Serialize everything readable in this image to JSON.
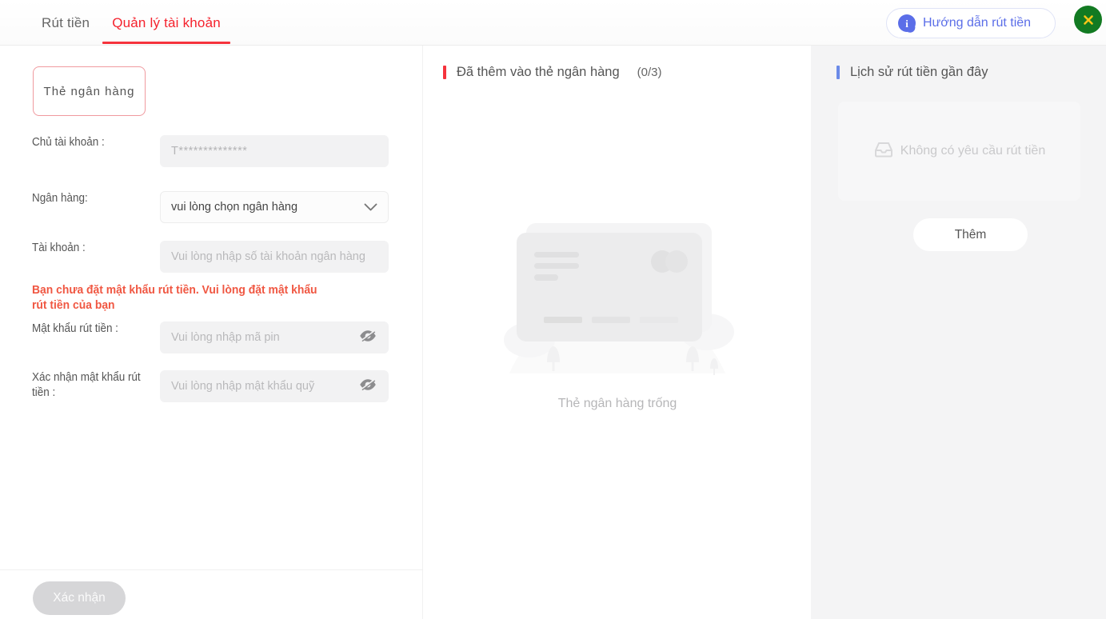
{
  "header": {
    "tabs": [
      {
        "label": "Rút tiền",
        "active": false
      },
      {
        "label": "Quản lý tài khoản",
        "active": true
      }
    ],
    "guide_button": {
      "label": "Hướng dẫn rút tiền",
      "icon": "info-bubble-icon"
    },
    "close_button": {
      "icon": "close-icon"
    }
  },
  "left_panel": {
    "card_tab_label": "Thẻ ngân hàng",
    "fields": [
      {
        "label": "Chủ tài khoản :",
        "value": "T**************",
        "placeholder": ""
      },
      {
        "label": "Ngân hàng:",
        "value": "vui lòng chọn ngân hàng",
        "placeholder": "vui lòng chọn ngân hàng"
      },
      {
        "label": "Tài khoản :",
        "value": "",
        "placeholder": "Vui lòng nhập số tài khoản ngân hàng"
      },
      {
        "label": "Mật khẩu rút tiền :",
        "value": "",
        "placeholder": "Vui lòng nhập mã pin"
      },
      {
        "label": "Xác nhận mật khẩu rút tiền :",
        "value": "",
        "placeholder": "Vui lòng nhập mật khẩu quỹ"
      }
    ],
    "warning": "Bạn chưa đặt mật khẩu rút tiền. Vui lòng đặt mật khẩu rút tiền của bạn",
    "confirm_label": "Xác nhận"
  },
  "middle_panel": {
    "title": "Đã thêm vào thẻ ngân hàng",
    "count": "(0/3)",
    "empty_caption": "Thẻ ngân hàng trống"
  },
  "right_panel": {
    "title": "Lịch sử rút tiền gần đây",
    "empty_text": "Không có yêu cầu rút tiền",
    "add_label": "Thêm"
  },
  "colors": {
    "accent_red": "#f5333c",
    "accent_blue": "#5b6ee8",
    "warning_red": "#f05742",
    "close_green": "#127a22",
    "close_x": "#f5c518"
  }
}
